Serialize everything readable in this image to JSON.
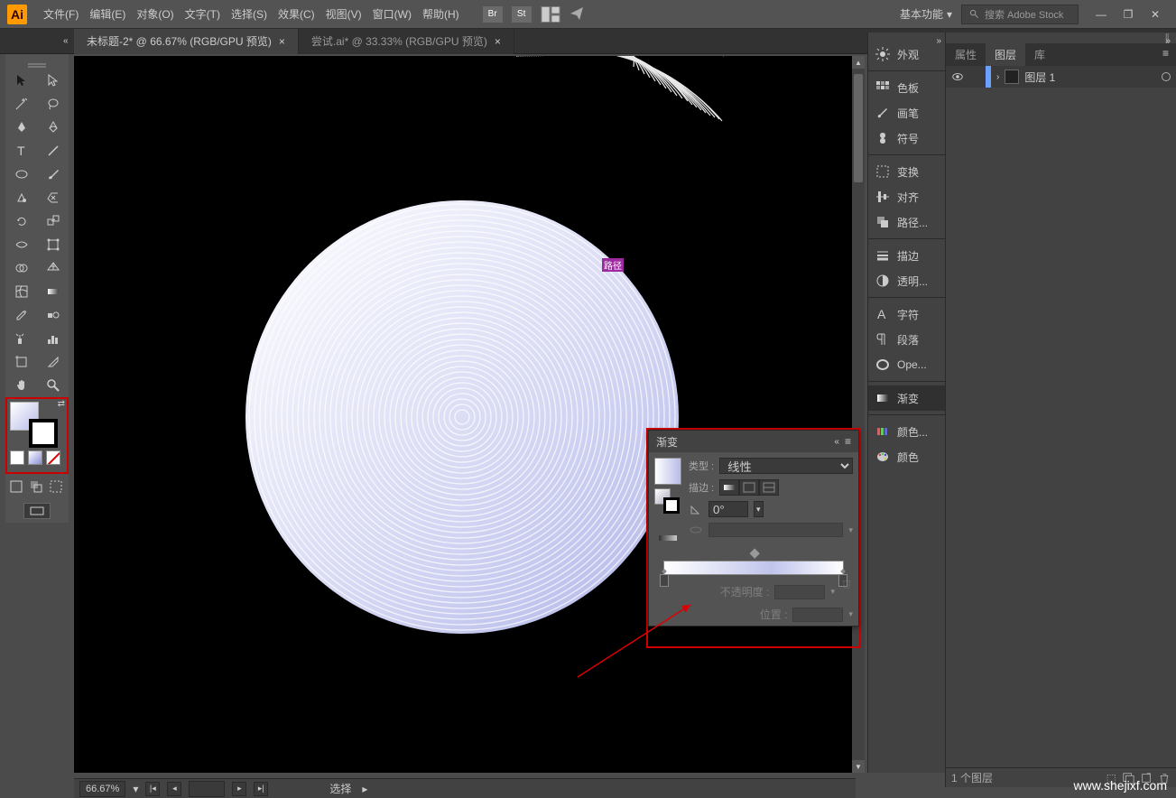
{
  "menu": {
    "items": [
      "文件(F)",
      "编辑(E)",
      "对象(O)",
      "文字(T)",
      "选择(S)",
      "效果(C)",
      "视图(V)",
      "窗口(W)",
      "帮助(H)"
    ],
    "icons": [
      "Br",
      "St"
    ],
    "workspace": "基本功能",
    "search_placeholder": "搜索 Adobe Stock"
  },
  "tabs": [
    {
      "label": "未标题-2* @ 66.67% (RGB/GPU 预览)",
      "active": true
    },
    {
      "label": "尝试.ai* @ 33.33% (RGB/GPU 预览)",
      "active": false
    }
  ],
  "canvas": {
    "path_label": "路径"
  },
  "side_panels": {
    "items": [
      {
        "icon": "sun",
        "label": "外观"
      },
      {
        "icon": "grid",
        "label": "色板"
      },
      {
        "icon": "brush",
        "label": "画笔"
      },
      {
        "icon": "club",
        "label": "符号"
      },
      {
        "icon": "transform",
        "label": "变换"
      },
      {
        "icon": "align",
        "label": "对齐"
      },
      {
        "icon": "pathfinder",
        "label": "路径..."
      },
      {
        "icon": "stroke",
        "label": "描边"
      },
      {
        "icon": "transparency",
        "label": "透明..."
      },
      {
        "icon": "A",
        "label": "字符"
      },
      {
        "icon": "para",
        "label": "段落"
      },
      {
        "icon": "O",
        "label": "Ope..."
      },
      {
        "icon": "gradient",
        "label": "渐变"
      },
      {
        "icon": "swatch",
        "label": "颜色..."
      },
      {
        "icon": "palette",
        "label": "颜色"
      }
    ]
  },
  "layers_panel": {
    "tabs": [
      "属性",
      "图层",
      "库"
    ],
    "active_tab": 1,
    "layer_name": "图层 1",
    "footer": "1 个图层"
  },
  "statusbar": {
    "zoom": "66.67%",
    "mode": "选择"
  },
  "gradient_panel": {
    "title": "渐变",
    "type_label": "类型 :",
    "type_value": "线性",
    "stroke_label": "描边 :",
    "angle_value": "0°",
    "opacity_label": "不透明度 :",
    "position_label": "位置 :"
  },
  "watermark": "www.shejixf.com"
}
